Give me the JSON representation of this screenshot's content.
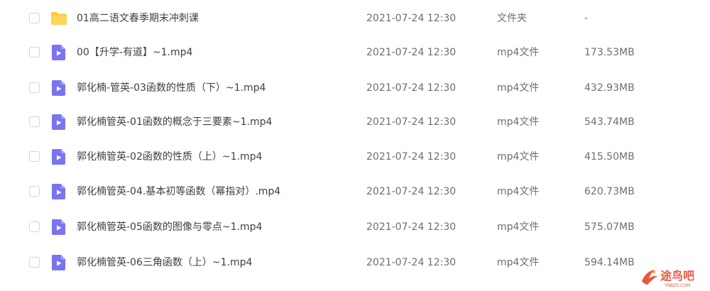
{
  "files": [
    {
      "name": "01高二语文春季期末冲刺课",
      "date": "2021-07-24 12:30",
      "type": "文件夹",
      "size": "-",
      "icon": "folder-icon"
    },
    {
      "name": "00【升学-有道】~1.mp4",
      "date": "2021-07-24 12:30",
      "type": "mp4文件",
      "size": "173.53MB",
      "icon": "video-file-icon"
    },
    {
      "name": "郭化楠-管英-03函数的性质（下）~1.mp4",
      "date": "2021-07-24 12:30",
      "type": "mp4文件",
      "size": "432.93MB",
      "icon": "video-file-icon"
    },
    {
      "name": "郭化楠管英-01函数的概念于三要素~1.mp4",
      "date": "2021-07-24 12:30",
      "type": "mp4文件",
      "size": "543.74MB",
      "icon": "video-file-icon"
    },
    {
      "name": "郭化楠管英-02函数的性质（上）~1.mp4",
      "date": "2021-07-24 12:30",
      "type": "mp4文件",
      "size": "415.50MB",
      "icon": "video-file-icon"
    },
    {
      "name": "郭化楠管英-04.基本初等函数（幂指对）.mp4",
      "date": "2021-07-24 12:30",
      "type": "mp4文件",
      "size": "620.73MB",
      "icon": "video-file-icon"
    },
    {
      "name": "郭化楠管英-05函数的图像与零点~1.mp4",
      "date": "2021-07-24 12:30",
      "type": "mp4文件",
      "size": "575.07MB",
      "icon": "video-file-icon"
    },
    {
      "name": "郭化楠管英-06三角函数（上）~1.mp4",
      "date": "2021-07-24 12:30",
      "type": "mp4文件",
      "size": "594.14MB",
      "icon": "video-file-icon"
    }
  ],
  "colors": {
    "folder": "#ffc93c",
    "video": "#7b74f0",
    "text": "#3c3f47",
    "muted": "#6a6e78",
    "watermark": "#e8573f"
  },
  "watermark": {
    "text": "途鸟吧",
    "url_text": "YNBZS.COM"
  }
}
